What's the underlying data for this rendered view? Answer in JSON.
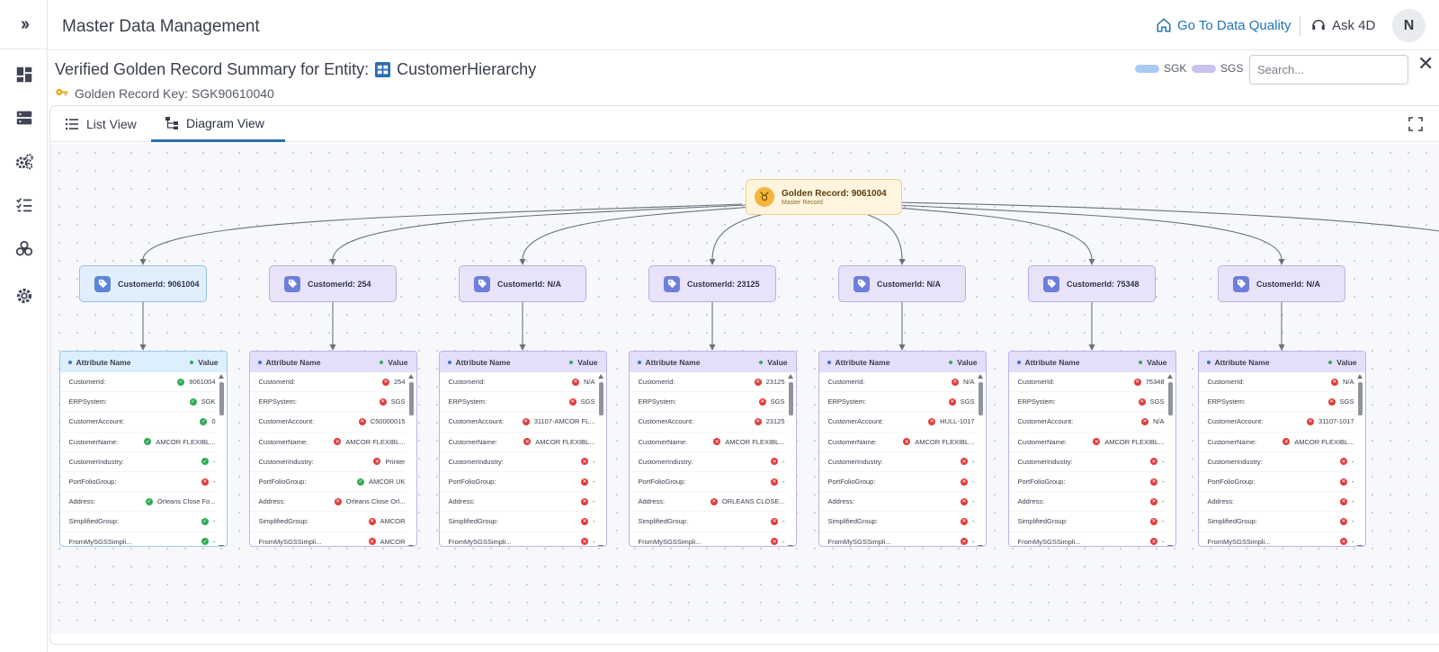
{
  "header": {
    "app_title": "Master Data Management",
    "go_to_data_quality": "Go To Data Quality",
    "ask_4d": "Ask 4D",
    "avatar_initial": "N"
  },
  "summary": {
    "title_prefix": "Verified Golden Record Summary for Entity:",
    "entity_name": "CustomerHierarchy",
    "golden_key": "Golden Record Key: SGK90610040"
  },
  "legend": [
    {
      "label": "SGK",
      "color": "#a9c9f5"
    },
    {
      "label": "SGS",
      "color": "#cbc1ee"
    }
  ],
  "search": {
    "placeholder": "Search..."
  },
  "tabs": {
    "list_view": "List View",
    "diagram_view": "Diagram View"
  },
  "colors": {
    "accent": "#1f73b8",
    "ok": "#2fab55",
    "error": "#e03b3b",
    "golden": "#f4b63a"
  },
  "diagram": {
    "golden": {
      "title": "Golden Record: 9061004",
      "subtitle": "Master Record"
    },
    "table_header": {
      "attr": "Attribute Name",
      "value": "Value"
    },
    "nodes": [
      {
        "label": "CustomerId: 9061004",
        "source": "sgk",
        "rows": [
          {
            "name": "CustomerId:",
            "value": "9061004",
            "status": "ok"
          },
          {
            "name": "ERPSystem:",
            "value": "SGK",
            "status": "ok"
          },
          {
            "name": "CustomerAccount:",
            "value": "0",
            "status": "ok"
          },
          {
            "name": "CustomerName:",
            "value": "AMCOR FLEXIBL...",
            "status": "ok"
          },
          {
            "name": "CustomerIndustry:",
            "value": "-",
            "status": "ok"
          },
          {
            "name": "PortFolioGroup:",
            "value": "-",
            "status": "bad"
          },
          {
            "name": "Address:",
            "value": "Orleans Close Fo...",
            "status": "ok"
          },
          {
            "name": "SimplifiedGroup:",
            "value": "-",
            "status": "ok"
          },
          {
            "name": "FromMySGSSimpli...",
            "value": "-",
            "status": "ok"
          }
        ]
      },
      {
        "label": "CustomerId: 254",
        "source": "sgs",
        "rows": [
          {
            "name": "CustomerId:",
            "value": "254",
            "status": "bad"
          },
          {
            "name": "ERPSystem:",
            "value": "SGS",
            "status": "bad"
          },
          {
            "name": "CustomerAccount:",
            "value": "C50000015",
            "status": "bad"
          },
          {
            "name": "CustomerName:",
            "value": "AMCOR FLEXIBL...",
            "status": "bad"
          },
          {
            "name": "CustomerIndustry:",
            "value": "Printer",
            "status": "bad"
          },
          {
            "name": "PortFolioGroup:",
            "value": "AMCOR UK",
            "status": "ok"
          },
          {
            "name": "Address:",
            "value": "Orleans Close Orl...",
            "status": "bad"
          },
          {
            "name": "SimplifiedGroup:",
            "value": "AMCOR",
            "status": "bad"
          },
          {
            "name": "FromMySGSSimpli...",
            "value": "AMCOR",
            "status": "bad"
          }
        ]
      },
      {
        "label": "CustomerId: N/A",
        "source": "sgs",
        "rows": [
          {
            "name": "CustomerId:",
            "value": "N/A",
            "status": "bad"
          },
          {
            "name": "ERPSystem:",
            "value": "SGS",
            "status": "bad"
          },
          {
            "name": "CustomerAccount:",
            "value": "31107-AMCOR FL...",
            "status": "bad"
          },
          {
            "name": "CustomerName:",
            "value": "AMCOR FLEXIBL...",
            "status": "bad"
          },
          {
            "name": "CustomerIndustry:",
            "value": "-",
            "status": "bad"
          },
          {
            "name": "PortFolioGroup:",
            "value": "-",
            "status": "bad"
          },
          {
            "name": "Address:",
            "value": "-",
            "status": "bad"
          },
          {
            "name": "SimplifiedGroup:",
            "value": "-",
            "status": "bad"
          },
          {
            "name": "FromMySGSSimpli...",
            "value": "-",
            "status": "bad"
          }
        ]
      },
      {
        "label": "CustomerId: 23125",
        "source": "sgs",
        "rows": [
          {
            "name": "CustomerId:",
            "value": "23125",
            "status": "bad"
          },
          {
            "name": "ERPSystem:",
            "value": "SGS",
            "status": "bad"
          },
          {
            "name": "CustomerAccount:",
            "value": "23125",
            "status": "bad"
          },
          {
            "name": "CustomerName:",
            "value": "AMCOR FLEXIBL...",
            "status": "bad"
          },
          {
            "name": "CustomerIndustry:",
            "value": "-",
            "status": "bad"
          },
          {
            "name": "PortFolioGroup:",
            "value": "-",
            "status": "bad"
          },
          {
            "name": "Address:",
            "value": "ORLEANS CLOSE...",
            "status": "bad"
          },
          {
            "name": "SimplifiedGroup:",
            "value": "-",
            "status": "bad"
          },
          {
            "name": "FromMySGSSimpli...",
            "value": "-",
            "status": "bad"
          }
        ]
      },
      {
        "label": "CustomerId: N/A",
        "source": "sgs",
        "rows": [
          {
            "name": "CustomerId:",
            "value": "N/A",
            "status": "bad"
          },
          {
            "name": "ERPSystem:",
            "value": "SGS",
            "status": "bad"
          },
          {
            "name": "CustomerAccount:",
            "value": "HULL-1017",
            "status": "bad"
          },
          {
            "name": "CustomerName:",
            "value": "AMCOR FLEXIBL...",
            "status": "bad"
          },
          {
            "name": "CustomerIndustry:",
            "value": "-",
            "status": "bad"
          },
          {
            "name": "PortFolioGroup:",
            "value": "-",
            "status": "bad"
          },
          {
            "name": "Address:",
            "value": "-",
            "status": "bad"
          },
          {
            "name": "SimplifiedGroup:",
            "value": "-",
            "status": "bad"
          },
          {
            "name": "FromMySGSSimpli...",
            "value": "-",
            "status": "bad"
          }
        ]
      },
      {
        "label": "CustomerId: 75348",
        "source": "sgs",
        "rows": [
          {
            "name": "CustomerId:",
            "value": "75348",
            "status": "bad"
          },
          {
            "name": "ERPSystem:",
            "value": "SGS",
            "status": "bad"
          },
          {
            "name": "CustomerAccount:",
            "value": "N/A",
            "status": "bad"
          },
          {
            "name": "CustomerName:",
            "value": "AMCOR FLEXIBL...",
            "status": "bad"
          },
          {
            "name": "CustomerIndustry:",
            "value": "-",
            "status": "bad"
          },
          {
            "name": "PortFolioGroup:",
            "value": "-",
            "status": "bad"
          },
          {
            "name": "Address:",
            "value": "-",
            "status": "bad"
          },
          {
            "name": "SimplifiedGroup:",
            "value": "-",
            "status": "bad"
          },
          {
            "name": "FromMySGSSimpli...",
            "value": "-",
            "status": "bad"
          }
        ]
      },
      {
        "label": "CustomerId: N/A",
        "source": "sgs",
        "rows": [
          {
            "name": "CustomerId:",
            "value": "N/A",
            "status": "bad"
          },
          {
            "name": "ERPSystem:",
            "value": "SGS",
            "status": "bad"
          },
          {
            "name": "CustomerAccount:",
            "value": "31107-1017",
            "status": "bad"
          },
          {
            "name": "CustomerName:",
            "value": "AMCOR FLEXIBL...",
            "status": "bad"
          },
          {
            "name": "CustomerIndustry:",
            "value": "-",
            "status": "bad"
          },
          {
            "name": "PortFolioGroup:",
            "value": "-",
            "status": "bad"
          },
          {
            "name": "Address:",
            "value": "-",
            "status": "bad"
          },
          {
            "name": "SimplifiedGroup:",
            "value": "-",
            "status": "bad"
          },
          {
            "name": "FromMySGSSimpli...",
            "value": "-",
            "status": "bad"
          }
        ]
      }
    ]
  }
}
